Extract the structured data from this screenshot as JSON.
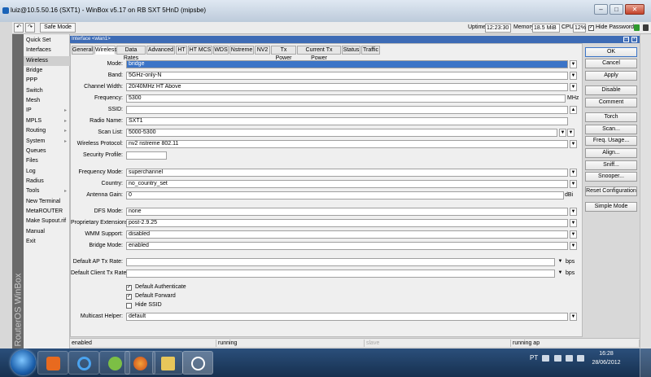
{
  "titlebar": {
    "title": "luiz@10.5.50.16 (SXT1) - WinBox v5.17 on RB SXT 5HnD (mipsbe)"
  },
  "toolbar": {
    "undo_icon": "undo-icon",
    "redo_icon": "redo-icon",
    "safe_mode": "Safe Mode",
    "uptime_label": "Uptime",
    "uptime_value": "12:23:30",
    "memory_label": "Memory",
    "memory_value": "18.5 MiB",
    "cpu_label": "CPU",
    "cpu_value": "12%",
    "hide_passwords": "Hide Passwords"
  },
  "sidebar": {
    "brand": "RouterOS WinBox",
    "items": [
      {
        "label": "Quick Set",
        "arrow": ""
      },
      {
        "label": "Interfaces",
        "arrow": ""
      },
      {
        "label": "Wireless",
        "arrow": ""
      },
      {
        "label": "Bridge",
        "arrow": ""
      },
      {
        "label": "PPP",
        "arrow": ""
      },
      {
        "label": "Switch",
        "arrow": ""
      },
      {
        "label": "Mesh",
        "arrow": ""
      },
      {
        "label": "IP",
        "arrow": "▸"
      },
      {
        "label": "MPLS",
        "arrow": "▸"
      },
      {
        "label": "Routing",
        "arrow": "▸"
      },
      {
        "label": "System",
        "arrow": "▸"
      },
      {
        "label": "Queues",
        "arrow": ""
      },
      {
        "label": "Files",
        "arrow": ""
      },
      {
        "label": "Log",
        "arrow": ""
      },
      {
        "label": "Radius",
        "arrow": ""
      },
      {
        "label": "Tools",
        "arrow": "▸"
      },
      {
        "label": "New Terminal",
        "arrow": ""
      },
      {
        "label": "MetaROUTER",
        "arrow": ""
      },
      {
        "label": "Make Supout.rif",
        "arrow": ""
      },
      {
        "label": "Manual",
        "arrow": ""
      },
      {
        "label": "Exit",
        "arrow": ""
      }
    ]
  },
  "window": {
    "title": "Interface <wlan1>",
    "tabs": [
      "General",
      "Wireless",
      "Data Rates",
      "Advanced",
      "HT",
      "HT MCS",
      "WDS",
      "Nstreme",
      "NV2",
      "Tx Power",
      "Current Tx Power",
      "Status",
      "Traffic"
    ],
    "active_tab": "Wireless"
  },
  "form": {
    "mode": {
      "label": "Mode:",
      "value": "bridge"
    },
    "band": {
      "label": "Band:",
      "value": "5GHz-only-N"
    },
    "channel_width": {
      "label": "Channel Width:",
      "value": "20/40MHz HT Above"
    },
    "frequency": {
      "label": "Frequency:",
      "value": "5300",
      "unit": "MHz"
    },
    "ssid": {
      "label": "SSID:",
      "value": ""
    },
    "radio_name": {
      "label": "Radio Name:",
      "value": "SXT1"
    },
    "scan_list": {
      "label": "Scan List:",
      "value": "5000-5300"
    },
    "wireless_protocol": {
      "label": "Wireless Protocol:",
      "value": "nv2 nstreme 802.11"
    },
    "security_profile": {
      "label": "Security Profile:",
      "value": ""
    },
    "frequency_mode": {
      "label": "Frequency Mode:",
      "value": "superchannel"
    },
    "country": {
      "label": "Country:",
      "value": "no_country_set"
    },
    "antenna_gain": {
      "label": "Antenna Gain:",
      "value": "0",
      "unit": "dBi"
    },
    "dfs_mode": {
      "label": "DFS Mode:",
      "value": "none"
    },
    "proprietary_extensions": {
      "label": "Proprietary Extensions:",
      "value": "post-2.9.25"
    },
    "wmm_support": {
      "label": "WMM Support:",
      "value": "disabled"
    },
    "bridge_mode": {
      "label": "Bridge Mode:",
      "value": "enabled"
    },
    "default_ap_tx_rate": {
      "label": "Default AP Tx Rate:",
      "value": "",
      "unit": "bps"
    },
    "default_client_tx_rate": {
      "label": "Default Client Tx Rate:",
      "value": "",
      "unit": "bps"
    },
    "default_authenticate": {
      "label": "Default Authenticate",
      "checked": true
    },
    "default_forward": {
      "label": "Default Forward",
      "checked": true
    },
    "hide_ssid": {
      "label": "Hide SSID",
      "checked": false
    },
    "multicast_helper": {
      "label": "Multicast Helper:",
      "value": "default"
    }
  },
  "actions": [
    "OK",
    "Cancel",
    "Apply",
    "Disable",
    "Comment",
    "Torch",
    "Scan...",
    "Freq. Usage...",
    "Align...",
    "Sniff...",
    "Snooper...",
    "Reset Configuration",
    "Simple Mode"
  ],
  "statusbar": [
    "enabled",
    "running",
    "slave",
    "running ap"
  ],
  "taskbar": {
    "lang": "PT",
    "time": "16:28",
    "date": "28/06/2012"
  },
  "colors": {
    "accent": "#3d6bb5",
    "selection": "#3b74c7",
    "taskbar": "#1f3d63"
  }
}
